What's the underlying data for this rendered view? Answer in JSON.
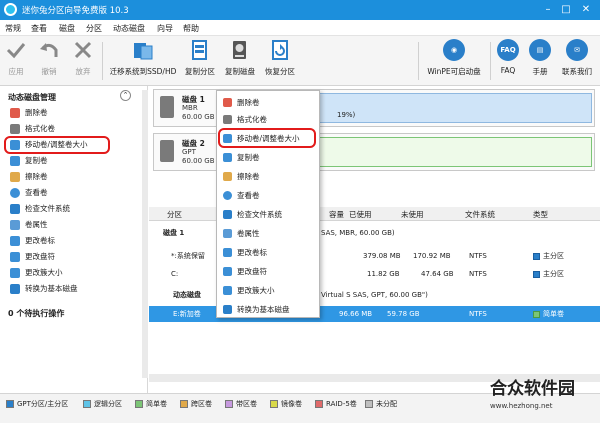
{
  "app": {
    "title": "迷你兔分区向导免费版 10.3"
  },
  "menu": [
    "常规",
    "查看",
    "磁盘",
    "分区",
    "动态磁盘",
    "向导",
    "帮助"
  ],
  "toolbar": {
    "apply": "应用",
    "undo": "撤销",
    "discard": "放弃",
    "migrate": "迁移系统到SSD/HD",
    "copy_partition": "复制分区",
    "copy_disk": "复制磁盘",
    "recover_partition": "恢复分区",
    "winpe": "WinPE可启动盘",
    "faq": "FAQ",
    "manual": "手册",
    "contact": "联系我们",
    "faq_icon_text": "FAQ"
  },
  "sidebar": {
    "section_title": "动态磁盘管理",
    "items": [
      "删除卷",
      "格式化卷",
      "移动卷/调整卷大小",
      "复制卷",
      "擦除卷",
      "查看卷",
      "检查文件系统",
      "卷属性",
      "更改卷标",
      "更改盘符",
      "更改簇大小",
      "转换为基本磁盘"
    ],
    "pending": "0 个待执行操作"
  },
  "disks": [
    {
      "name": "磁盘 1",
      "type": "MBR",
      "size": "60.00 GB",
      "bar_text": "19%)"
    },
    {
      "name": "磁盘 2",
      "type": "GPT",
      "size": "60.00 GB"
    }
  ],
  "table": {
    "columns": [
      "分区",
      "容量",
      "已使用",
      "未使用",
      "文件系统",
      "类型"
    ],
    "disk1_header": "磁盘 1",
    "disk1_desc": "SAS, MBR, 60.00 GB)",
    "rows": [
      {
        "partition": "*:系统保留",
        "used": "379.08 MB",
        "unused": "170.92 MB",
        "fs": "NTFS",
        "type": "主分区"
      },
      {
        "partition": "C:",
        "used": "11.82 GB",
        "unused": "47.64 GB",
        "fs": "NTFS",
        "type": "主分区"
      }
    ],
    "dyn_header": "动态磁盘",
    "dyn_desc": "Virtual S SAS, GPT, 60.00 GB\")",
    "selected": {
      "partition": "E:新加卷",
      "used": "96.66 MB",
      "unused": "59.78 GB",
      "fs": "NTFS",
      "type": "简单卷"
    }
  },
  "context_menu": [
    "删除卷",
    "格式化卷",
    "移动卷/调整卷大小",
    "复制卷",
    "擦除卷",
    "查看卷",
    "检查文件系统",
    "卷属性",
    "更改卷标",
    "更改盘符",
    "更改簇大小",
    "转换为基本磁盘"
  ],
  "legend": [
    "GPT分区/主分区",
    "逻辑分区",
    "简单卷",
    "跨区卷",
    "带区卷",
    "镜像卷",
    "RAID-5卷",
    "未分配"
  ],
  "legend_colors": [
    "#2a7fc9",
    "#5fc4e8",
    "#7cc576",
    "#e0a94a",
    "#c79adf",
    "#d9d94a",
    "#e06a6a",
    "#bfbfbf"
  ],
  "brand": {
    "name": "合众软件园",
    "url": "www.hezhong.net"
  }
}
